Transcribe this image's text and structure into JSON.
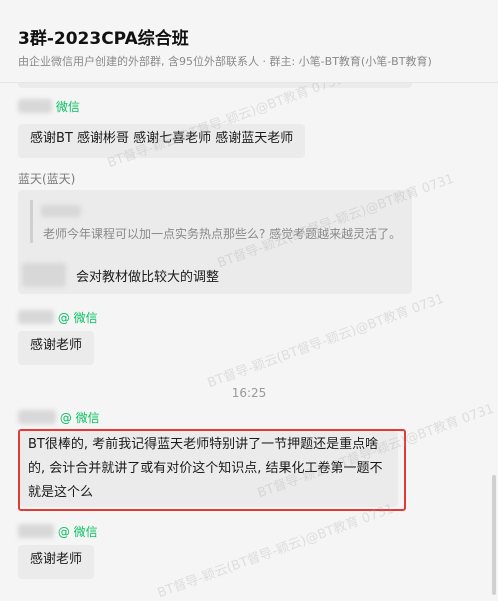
{
  "header": {
    "title": "3群-2023CPA综合班",
    "subtitle": "由企业微信用户创建的外部群, 含95位外部联系人 · 群主: 小笔-BT教育(小笔-BT教育)"
  },
  "messages": [
    {
      "sender_suffix": "微信",
      "text": "感谢BT  感谢彬哥  感谢七喜老师 感谢蓝天老师"
    },
    {
      "sender": "蓝天(蓝天)",
      "quote": "老师今年课程可以加一点实务热点那些么? 感觉考题越来越灵活了。",
      "text": "会对教材做比较大的调整"
    },
    {
      "sender_suffix": "@ 微信",
      "text": "感谢老师"
    },
    {
      "sender_suffix": "@ 微信",
      "text_lines": [
        "BT很棒的, 考前我记得蓝天老师特别讲了一节押题还是重点啥",
        "的, 会计合并就讲了或有对价这个知识点, 结果化工卷第一题不",
        "就是这个么"
      ]
    },
    {
      "sender_suffix": "@ 微信",
      "text": "感谢老师"
    }
  ],
  "timestamp": "16:25",
  "watermark": "BT督导-颖云(BT督导-颖云)@BT教育 0731",
  "colors": {
    "accent": "#07c160",
    "highlight": "#e53935"
  }
}
